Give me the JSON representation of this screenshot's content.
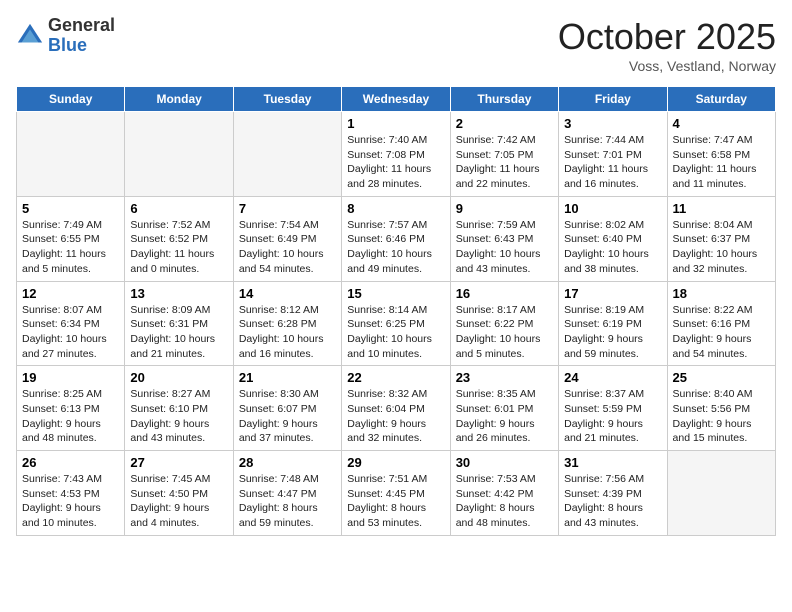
{
  "header": {
    "logo_general": "General",
    "logo_blue": "Blue",
    "month": "October 2025",
    "location": "Voss, Vestland, Norway"
  },
  "days_of_week": [
    "Sunday",
    "Monday",
    "Tuesday",
    "Wednesday",
    "Thursday",
    "Friday",
    "Saturday"
  ],
  "weeks": [
    [
      {
        "day": "",
        "empty": true
      },
      {
        "day": "",
        "empty": true
      },
      {
        "day": "",
        "empty": true
      },
      {
        "day": "1",
        "sunrise": "Sunrise: 7:40 AM",
        "sunset": "Sunset: 7:08 PM",
        "daylight": "Daylight: 11 hours and 28 minutes."
      },
      {
        "day": "2",
        "sunrise": "Sunrise: 7:42 AM",
        "sunset": "Sunset: 7:05 PM",
        "daylight": "Daylight: 11 hours and 22 minutes."
      },
      {
        "day": "3",
        "sunrise": "Sunrise: 7:44 AM",
        "sunset": "Sunset: 7:01 PM",
        "daylight": "Daylight: 11 hours and 16 minutes."
      },
      {
        "day": "4",
        "sunrise": "Sunrise: 7:47 AM",
        "sunset": "Sunset: 6:58 PM",
        "daylight": "Daylight: 11 hours and 11 minutes."
      }
    ],
    [
      {
        "day": "5",
        "sunrise": "Sunrise: 7:49 AM",
        "sunset": "Sunset: 6:55 PM",
        "daylight": "Daylight: 11 hours and 5 minutes."
      },
      {
        "day": "6",
        "sunrise": "Sunrise: 7:52 AM",
        "sunset": "Sunset: 6:52 PM",
        "daylight": "Daylight: 11 hours and 0 minutes."
      },
      {
        "day": "7",
        "sunrise": "Sunrise: 7:54 AM",
        "sunset": "Sunset: 6:49 PM",
        "daylight": "Daylight: 10 hours and 54 minutes."
      },
      {
        "day": "8",
        "sunrise": "Sunrise: 7:57 AM",
        "sunset": "Sunset: 6:46 PM",
        "daylight": "Daylight: 10 hours and 49 minutes."
      },
      {
        "day": "9",
        "sunrise": "Sunrise: 7:59 AM",
        "sunset": "Sunset: 6:43 PM",
        "daylight": "Daylight: 10 hours and 43 minutes."
      },
      {
        "day": "10",
        "sunrise": "Sunrise: 8:02 AM",
        "sunset": "Sunset: 6:40 PM",
        "daylight": "Daylight: 10 hours and 38 minutes."
      },
      {
        "day": "11",
        "sunrise": "Sunrise: 8:04 AM",
        "sunset": "Sunset: 6:37 PM",
        "daylight": "Daylight: 10 hours and 32 minutes."
      }
    ],
    [
      {
        "day": "12",
        "sunrise": "Sunrise: 8:07 AM",
        "sunset": "Sunset: 6:34 PM",
        "daylight": "Daylight: 10 hours and 27 minutes."
      },
      {
        "day": "13",
        "sunrise": "Sunrise: 8:09 AM",
        "sunset": "Sunset: 6:31 PM",
        "daylight": "Daylight: 10 hours and 21 minutes."
      },
      {
        "day": "14",
        "sunrise": "Sunrise: 8:12 AM",
        "sunset": "Sunset: 6:28 PM",
        "daylight": "Daylight: 10 hours and 16 minutes."
      },
      {
        "day": "15",
        "sunrise": "Sunrise: 8:14 AM",
        "sunset": "Sunset: 6:25 PM",
        "daylight": "Daylight: 10 hours and 10 minutes."
      },
      {
        "day": "16",
        "sunrise": "Sunrise: 8:17 AM",
        "sunset": "Sunset: 6:22 PM",
        "daylight": "Daylight: 10 hours and 5 minutes."
      },
      {
        "day": "17",
        "sunrise": "Sunrise: 8:19 AM",
        "sunset": "Sunset: 6:19 PM",
        "daylight": "Daylight: 9 hours and 59 minutes."
      },
      {
        "day": "18",
        "sunrise": "Sunrise: 8:22 AM",
        "sunset": "Sunset: 6:16 PM",
        "daylight": "Daylight: 9 hours and 54 minutes."
      }
    ],
    [
      {
        "day": "19",
        "sunrise": "Sunrise: 8:25 AM",
        "sunset": "Sunset: 6:13 PM",
        "daylight": "Daylight: 9 hours and 48 minutes."
      },
      {
        "day": "20",
        "sunrise": "Sunrise: 8:27 AM",
        "sunset": "Sunset: 6:10 PM",
        "daylight": "Daylight: 9 hours and 43 minutes."
      },
      {
        "day": "21",
        "sunrise": "Sunrise: 8:30 AM",
        "sunset": "Sunset: 6:07 PM",
        "daylight": "Daylight: 9 hours and 37 minutes."
      },
      {
        "day": "22",
        "sunrise": "Sunrise: 8:32 AM",
        "sunset": "Sunset: 6:04 PM",
        "daylight": "Daylight: 9 hours and 32 minutes."
      },
      {
        "day": "23",
        "sunrise": "Sunrise: 8:35 AM",
        "sunset": "Sunset: 6:01 PM",
        "daylight": "Daylight: 9 hours and 26 minutes."
      },
      {
        "day": "24",
        "sunrise": "Sunrise: 8:37 AM",
        "sunset": "Sunset: 5:59 PM",
        "daylight": "Daylight: 9 hours and 21 minutes."
      },
      {
        "day": "25",
        "sunrise": "Sunrise: 8:40 AM",
        "sunset": "Sunset: 5:56 PM",
        "daylight": "Daylight: 9 hours and 15 minutes."
      }
    ],
    [
      {
        "day": "26",
        "sunrise": "Sunrise: 7:43 AM",
        "sunset": "Sunset: 4:53 PM",
        "daylight": "Daylight: 9 hours and 10 minutes."
      },
      {
        "day": "27",
        "sunrise": "Sunrise: 7:45 AM",
        "sunset": "Sunset: 4:50 PM",
        "daylight": "Daylight: 9 hours and 4 minutes."
      },
      {
        "day": "28",
        "sunrise": "Sunrise: 7:48 AM",
        "sunset": "Sunset: 4:47 PM",
        "daylight": "Daylight: 8 hours and 59 minutes."
      },
      {
        "day": "29",
        "sunrise": "Sunrise: 7:51 AM",
        "sunset": "Sunset: 4:45 PM",
        "daylight": "Daylight: 8 hours and 53 minutes."
      },
      {
        "day": "30",
        "sunrise": "Sunrise: 7:53 AM",
        "sunset": "Sunset: 4:42 PM",
        "daylight": "Daylight: 8 hours and 48 minutes."
      },
      {
        "day": "31",
        "sunrise": "Sunrise: 7:56 AM",
        "sunset": "Sunset: 4:39 PM",
        "daylight": "Daylight: 8 hours and 43 minutes."
      },
      {
        "day": "",
        "empty": true
      }
    ]
  ]
}
